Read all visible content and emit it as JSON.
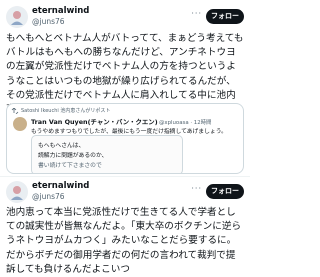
{
  "post1": {
    "display_name": "eternalwind",
    "handle": "@juns76",
    "follow_label": "フォロー",
    "more_label": "···",
    "text": "もへもへとベトナム人がバトってて、まぁどう考えてもバトルはもへもへの勝ちなんだけど、アンチネトウヨの左翼が党派性だけでベトナム人の方を持つというようなことはいつもの地獄が繰り広げられてるんだが、その党派性だけでベトナム人に肩入れしてる中に池内恵がいて草"
  },
  "quote": {
    "header": "Satoshi Ikeuchi 池内恵さんがリポスト",
    "name": "Tran Van Quyen(チャン・バン・クエン)",
    "handle": "@xpluoasa · 12時間",
    "text": "もうやめますつもりでしたが、最後にもう一度だけ指摘してあげましょう。",
    "inner_lines": [
      "もへもへさんは、",
      "読解力に問題があるのか、",
      "書い続けて下さまさので"
    ]
  },
  "post2": {
    "display_name": "eternalwind",
    "handle": "@juns76",
    "follow_label": "フォロー",
    "more_label": "···",
    "text": "池内恵って本当に党派性だけで生きてる人で学者としての誠実性が皆無なんだよ。「東大卒のボクチンに逆らうネトウヨがムカつく」みたいなことだら要するに。だからボチだの御用学者だの何だの言われて裁判で提訴しても負けるんだよこいつ"
  }
}
